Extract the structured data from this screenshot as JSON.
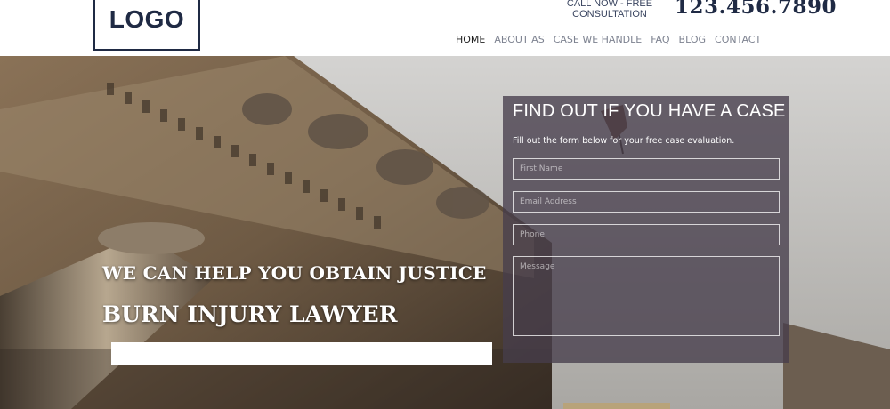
{
  "header": {
    "logo": "LOGO",
    "call_now": "CALL NOW - FREE CONSULTATION",
    "phone": "123.456.7890"
  },
  "nav": {
    "items": [
      {
        "label": "HOME",
        "active": true
      },
      {
        "label": "ABOUT AS",
        "active": false
      },
      {
        "label": "CASE WE HANDLE",
        "active": false
      },
      {
        "label": "FAQ",
        "active": false
      },
      {
        "label": "BLOG",
        "active": false
      },
      {
        "label": "CONTACT",
        "active": false
      }
    ]
  },
  "hero": {
    "tagline": "WE CAN HELP YOU OBTAIN JUSTICE",
    "headline": "BURN INJURY LAWYER"
  },
  "form": {
    "title": "FIND OUT IF YOU HAVE A CASE",
    "subtitle": "Fill out the form below for your free case evaluation.",
    "first_name_placeholder": "First Name",
    "email_placeholder": "Email Address",
    "phone_placeholder": "Phone",
    "message_placeholder": "Message"
  },
  "colors": {
    "brand_navy": "#1f2a44",
    "panel_overlay": "#463e4b",
    "accent_gold": "#b8a37a"
  }
}
